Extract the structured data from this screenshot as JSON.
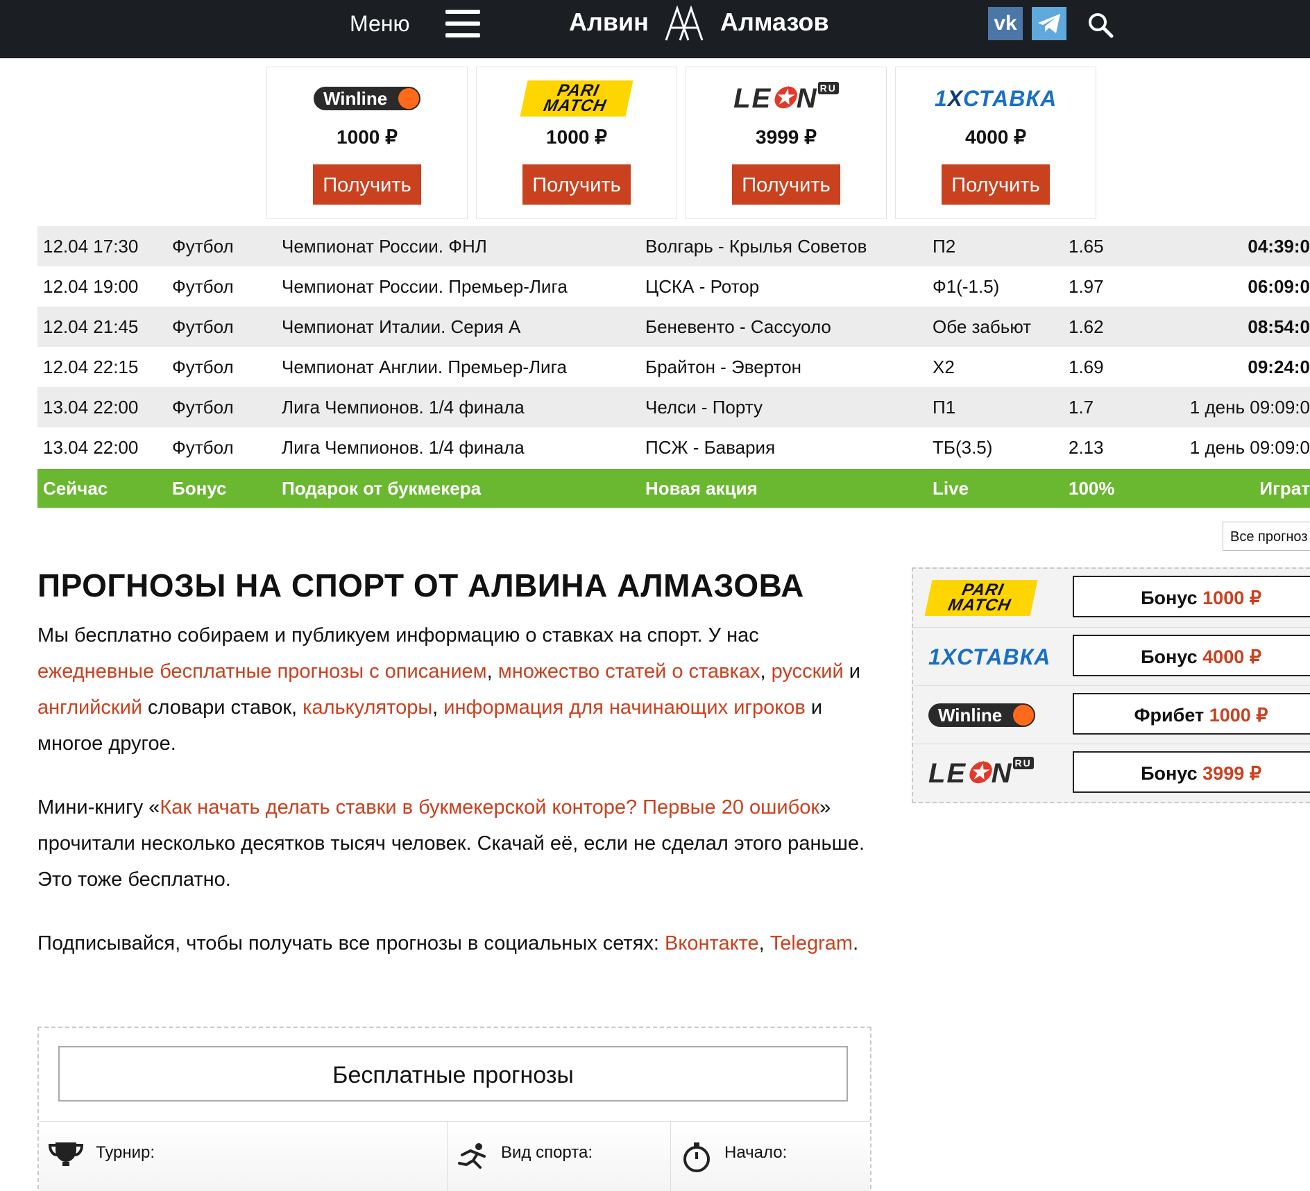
{
  "header": {
    "menu_label": "Меню",
    "brand_first": "Алвин",
    "brand_last": "Алмазов",
    "social": [
      "vk-icon",
      "telegram-icon"
    ],
    "search_icon": "search-icon"
  },
  "bookmakers": [
    {
      "name": "Winline",
      "amount": "1000 ₽",
      "button": "Получить"
    },
    {
      "name": "Parimatch",
      "amount": "1000 ₽",
      "button": "Получить"
    },
    {
      "name": "Leon",
      "amount": "3999 ₽",
      "button": "Получить"
    },
    {
      "name": "1XСТАВКА",
      "amount": "4000 ₽",
      "button": "Получить"
    }
  ],
  "forecasts": [
    {
      "time": "12.04 17:30",
      "sport": "Футбол",
      "league": "Чемпионат России. ФНЛ",
      "match": "Волгарь - Крылья Советов",
      "bet": "П2",
      "coef": "1.65",
      "countdown": "04:39:0"
    },
    {
      "time": "12.04 19:00",
      "sport": "Футбол",
      "league": "Чемпионат России. Премьер-Лига",
      "match": "ЦСКА - Ротор",
      "bet": "Ф1(-1.5)",
      "coef": "1.97",
      "countdown": "06:09:0"
    },
    {
      "time": "12.04 21:45",
      "sport": "Футбол",
      "league": "Чемпионат Италии. Серия А",
      "match": "Беневенто - Сассуоло",
      "bet": "Обе забьют",
      "coef": "1.62",
      "countdown": "08:54:0"
    },
    {
      "time": "12.04 22:15",
      "sport": "Футбол",
      "league": "Чемпионат Англии. Премьер-Лига",
      "match": "Брайтон - Эвертон",
      "bet": "Х2",
      "coef": "1.69",
      "countdown": "09:24:0"
    },
    {
      "time": "13.04 22:00",
      "sport": "Футбол",
      "league": "Лига Чемпионов. 1/4 финала",
      "match": "Челси - Порту",
      "bet": "П1",
      "coef": "1.7",
      "countdown": "1 день 09:09:0"
    },
    {
      "time": "13.04 22:00",
      "sport": "Футбол",
      "league": "Лига Чемпионов. 1/4 финала",
      "match": "ПСЖ - Бавария",
      "bet": "ТБ(3.5)",
      "coef": "2.13",
      "countdown": "1 день 09:09:0"
    }
  ],
  "promo_row": {
    "time": "Сейчас",
    "sport": "Бонус",
    "league": "Подарок от букмекера",
    "match": "Новая акция",
    "bet": "Live",
    "coef": "100%",
    "action": "Играт"
  },
  "all_forecasts_button": "Все прогноз",
  "main": {
    "title": "ПРОГНОЗЫ НА СПОРТ ОТ АЛВИНА АЛМАЗОВА",
    "p1": {
      "t1": "Мы бесплатно собираем и публикуем информацию о ставках на спорт. У нас ",
      "l1": "ежедневные бесплатные прогнозы с описанием",
      "t2": ", ",
      "l2": "множество статей о ставках",
      "t3": ", ",
      "l3": "русский",
      "t4": " и ",
      "l4": "английский",
      "t5": " словари ставок, ",
      "l5": "калькуляторы",
      "t6": ", ",
      "l6": "информация для начинающих игроков",
      "t7": " и многое другое."
    },
    "p2": {
      "t1": "Мини-книгу «",
      "l1": "Как начать делать ставки в букмекерской конторе? Первые 20 ошибок",
      "t2": "» прочитали несколько десятков тысяч человек. Скачай её, если не сделал этого раньше. Это тоже бесплатно."
    },
    "p3": {
      "t1": "Подписывайся, чтобы получать все прогнозы в социальных сетях: ",
      "l1": "Вконтакте",
      "t2": ", ",
      "l2": "Telegram",
      "t3": "."
    }
  },
  "sidebar_bonuses": [
    {
      "name": "Parimatch",
      "label": "Бонус ",
      "amount": "1000 ₽"
    },
    {
      "name": "1XСТАВКА",
      "label": "Бонус ",
      "amount": "4000 ₽"
    },
    {
      "name": "Winline",
      "label": "Фрибет ",
      "amount": "1000 ₽"
    },
    {
      "name": "Leon",
      "label": "Бонус ",
      "amount": "3999 ₽"
    }
  ],
  "free_forecasts": {
    "title": "Бесплатные прогнозы",
    "filters": [
      "Турнир:",
      "Вид спорта:",
      "Начало:"
    ]
  },
  "colors": {
    "accent": "#c9411f",
    "topbar": "#1b1f24",
    "promo_green": "#6ab730"
  }
}
